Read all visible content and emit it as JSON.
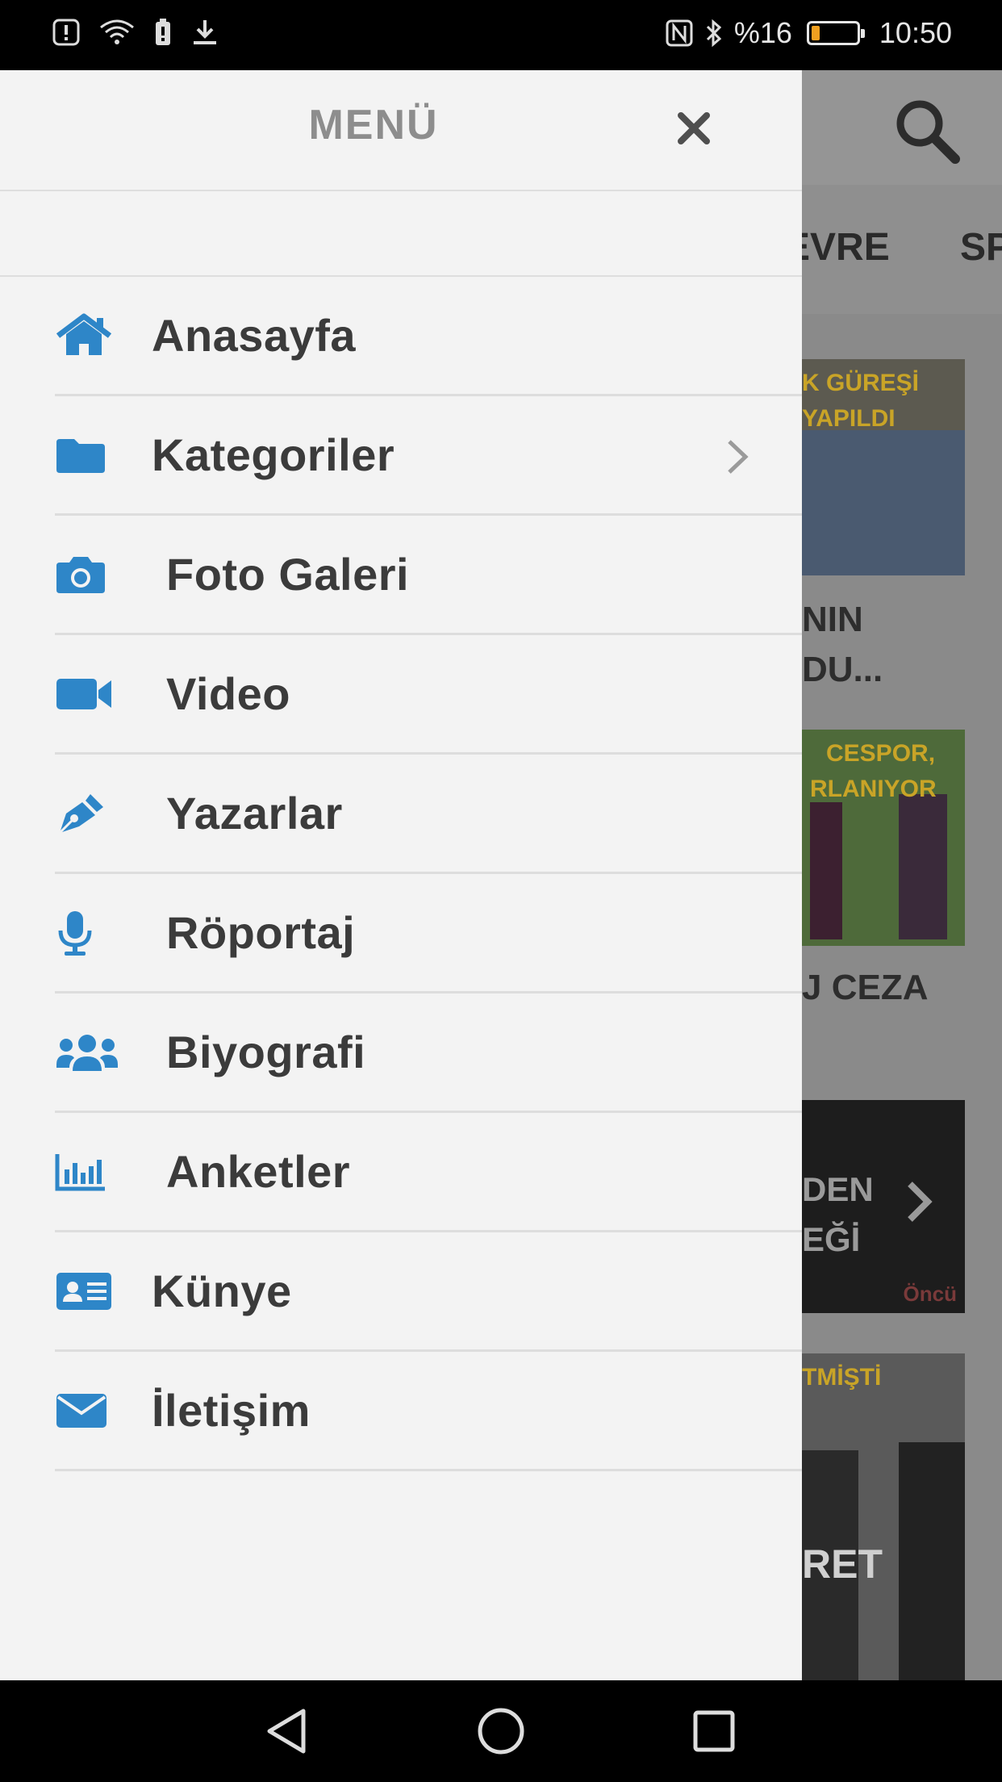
{
  "status_bar": {
    "battery_text": "%16",
    "time": "10:50",
    "battery_level": 0.16
  },
  "drawer": {
    "title": "MENÜ",
    "items": [
      {
        "label": "Anasayfa",
        "icon": "home-icon"
      },
      {
        "label": "Kategoriler",
        "icon": "folder-icon",
        "has_submenu": true
      },
      {
        "label": "Foto Galeri",
        "icon": "camera-icon"
      },
      {
        "label": "Video",
        "icon": "video-camera-icon"
      },
      {
        "label": "Yazarlar",
        "icon": "pen-icon"
      },
      {
        "label": "Röportaj",
        "icon": "microphone-icon"
      },
      {
        "label": "Biyografi",
        "icon": "users-icon"
      },
      {
        "label": "Anketler",
        "icon": "bar-chart-icon"
      },
      {
        "label": "Künye",
        "icon": "id-card-icon"
      },
      {
        "label": "İletişim",
        "icon": "envelope-icon"
      }
    ]
  },
  "background": {
    "tabs": [
      "EVRE",
      "SP"
    ],
    "cards": [
      {
        "image_text": [
          "K GÜREŞİ",
          "YAPILDI"
        ],
        "title": [
          "NIN",
          "DU..."
        ]
      },
      {
        "image_text": [
          "CESPOR,",
          "RLANIYOR"
        ],
        "title": [
          "J CEZA"
        ]
      },
      {
        "image_text": [
          "DEN",
          "EĞİ"
        ],
        "logo": "Öncü"
      },
      {
        "image_text": [
          "TMİŞTİ"
        ],
        "title": [
          "RET"
        ]
      }
    ]
  },
  "colors": {
    "accent_icon": "#2e86c8",
    "drawer_bg": "#f3f3f3",
    "label": "#3b3b3b"
  }
}
